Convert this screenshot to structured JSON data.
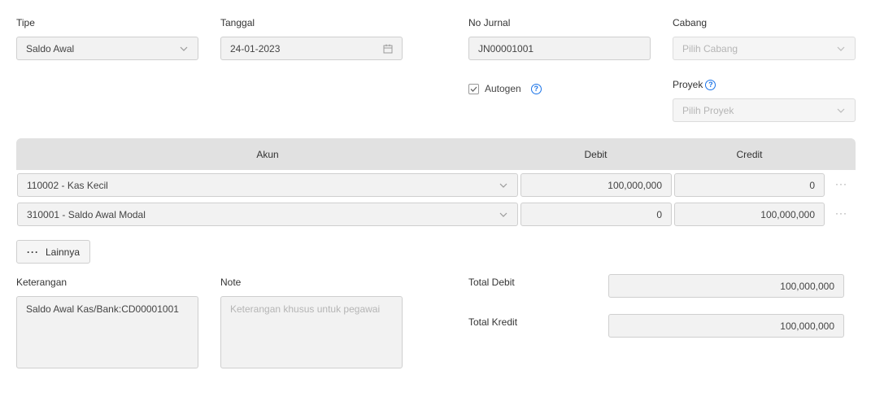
{
  "header": {
    "tipe": {
      "label": "Tipe",
      "value": "Saldo Awal"
    },
    "tanggal": {
      "label": "Tanggal",
      "value": "24-01-2023"
    },
    "no_jurnal": {
      "label": "No Jurnal",
      "value": "JN00001001"
    },
    "cabang": {
      "label": "Cabang",
      "placeholder": "Pilih Cabang"
    },
    "autogen": {
      "label": "Autogen",
      "checked": true
    },
    "proyek": {
      "label": "Proyek",
      "placeholder": "Pilih Proyek"
    }
  },
  "table": {
    "columns": [
      "Akun",
      "Debit",
      "Credit"
    ],
    "rows": [
      {
        "akun": "110002 - Kas Kecil",
        "debit": "100,000,000",
        "credit": "0"
      },
      {
        "akun": "310001 - Saldo Awal Modal",
        "debit": "0",
        "credit": "100,000,000"
      }
    ],
    "more_label": "Lainnya"
  },
  "footer": {
    "keterangan": {
      "label": "Keterangan",
      "value": "Saldo Awal Kas/Bank:CD00001001"
    },
    "note": {
      "label": "Note",
      "placeholder": "Keterangan khusus untuk pegawai"
    },
    "total_debit": {
      "label": "Total Debit",
      "value": "100,000,000"
    },
    "total_kredit": {
      "label": "Total Kredit",
      "value": "100,000,000"
    }
  },
  "icons": {
    "chevron": "chevron-down-icon",
    "calendar": "calendar-icon",
    "help": "help-icon",
    "check": "check-icon",
    "more": "more-horizontal-icon"
  },
  "colors": {
    "accent": "#1a73e8",
    "header_bg": "#e1e1e1",
    "field_bg": "#f2f2f2"
  }
}
